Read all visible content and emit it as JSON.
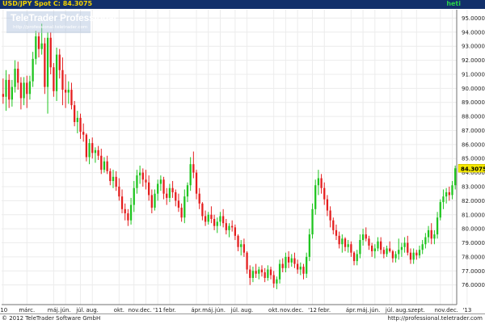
{
  "header": {
    "instrument": "USD/JPY Spot C: 84.3075",
    "interval": "heti",
    "period": "heti"
  },
  "watermark": {
    "brand": "TeleTrader Professional",
    "url": "http://professional.teletrader.com"
  },
  "footer": {
    "copyright": "© 2012 TeleTrader Software GmbH",
    "url": "http://professional.teletrader.com"
  },
  "colors": {
    "up": "#1fc41f",
    "down": "#e41e1e",
    "grid": "#ececec",
    "title_bg": "#12306b",
    "last_price_bg": "#f4e800"
  },
  "chart_data": {
    "type": "candlestick",
    "grid": true,
    "y_axis_side": "right",
    "ylim": [
      74.6,
      95.6
    ],
    "last_price": "84.3075",
    "y_ticks": [
      "76.0000",
      "77.0000",
      "78.0000",
      "79.0000",
      "80.0000",
      "81.0000",
      "82.0000",
      "83.0000",
      "84.0000",
      "85.0000",
      "86.0000",
      "87.0000",
      "88.0000",
      "89.0000",
      "90.0000",
      "91.0000",
      "92.0000",
      "93.0000",
      "94.0000",
      "95.0000"
    ],
    "x_ticks": [
      {
        "i": 0,
        "label": "'10"
      },
      {
        "i": 8,
        "label": "márc."
      },
      {
        "i": 17,
        "label": "máj."
      },
      {
        "i": 21,
        "label": "jún."
      },
      {
        "i": 26,
        "label": "júl."
      },
      {
        "i": 30,
        "label": "aug."
      },
      {
        "i": 39,
        "label": "okt."
      },
      {
        "i": 44,
        "label": "nov."
      },
      {
        "i": 48,
        "label": "dec."
      },
      {
        "i": 52,
        "label": "'11"
      },
      {
        "i": 56,
        "label": "febr."
      },
      {
        "i": 65,
        "label": "ápr."
      },
      {
        "i": 69,
        "label": "máj."
      },
      {
        "i": 73,
        "label": "jún."
      },
      {
        "i": 78,
        "label": "júl."
      },
      {
        "i": 82,
        "label": "aug."
      },
      {
        "i": 91,
        "label": "okt."
      },
      {
        "i": 95,
        "label": "nov."
      },
      {
        "i": 99,
        "label": "dec."
      },
      {
        "i": 104,
        "label": "'12"
      },
      {
        "i": 108,
        "label": "febr."
      },
      {
        "i": 117,
        "label": "ápr."
      },
      {
        "i": 121,
        "label": "máj."
      },
      {
        "i": 125,
        "label": "jún."
      },
      {
        "i": 130,
        "label": "júl."
      },
      {
        "i": 134,
        "label": "aug."
      },
      {
        "i": 139,
        "label": "szept."
      },
      {
        "i": 147,
        "label": "nov."
      },
      {
        "i": 151,
        "label": "dec."
      },
      {
        "i": 156,
        "label": "'13"
      }
    ],
    "candles": [
      [
        89.6,
        90.7,
        88.9,
        89.4
      ],
      [
        89.4,
        91.3,
        88.4,
        90.6
      ],
      [
        90.6,
        91.0,
        88.6,
        89.2
      ],
      [
        89.2,
        90.6,
        88.7,
        90.1
      ],
      [
        90.1,
        92.0,
        89.7,
        91.4
      ],
      [
        91.4,
        91.9,
        89.9,
        90.4
      ],
      [
        90.4,
        90.8,
        88.5,
        89.3
      ],
      [
        89.3,
        90.8,
        88.8,
        90.4
      ],
      [
        90.4,
        90.9,
        88.6,
        89.6
      ],
      [
        89.6,
        90.9,
        89.2,
        90.5
      ],
      [
        90.5,
        92.6,
        90.1,
        92.1
      ],
      [
        92.1,
        94.1,
        91.7,
        93.7
      ],
      [
        93.7,
        94.0,
        92.2,
        92.8
      ],
      [
        92.8,
        94.6,
        92.4,
        93.2
      ],
      [
        93.2,
        93.6,
        89.6,
        90.1
      ],
      [
        90.1,
        94.0,
        88.2,
        93.6
      ],
      [
        93.6,
        94.0,
        91.0,
        91.5
      ],
      [
        91.5,
        91.8,
        89.4,
        89.8
      ],
      [
        89.8,
        92.9,
        89.1,
        92.4
      ],
      [
        92.4,
        92.8,
        90.7,
        91.3
      ],
      [
        91.3,
        92.2,
        88.8,
        89.9
      ],
      [
        89.9,
        91.0,
        88.6,
        89.7
      ],
      [
        89.7,
        90.5,
        88.9,
        89.9
      ],
      [
        89.9,
        90.4,
        88.5,
        88.8
      ],
      [
        88.8,
        89.1,
        87.3,
        87.6
      ],
      [
        87.6,
        88.4,
        86.8,
        87.9
      ],
      [
        87.9,
        88.2,
        86.4,
        86.9
      ],
      [
        86.9,
        87.5,
        86.2,
        86.7
      ],
      [
        86.7,
        86.8,
        84.8,
        85.1
      ],
      [
        85.1,
        86.4,
        84.6,
        86.1
      ],
      [
        86.1,
        86.5,
        85.0,
        85.4
      ],
      [
        85.4,
        85.8,
        84.7,
        85.6
      ],
      [
        85.6,
        85.9,
        84.9,
        85.2
      ],
      [
        85.2,
        85.7,
        83.9,
        84.2
      ],
      [
        84.2,
        85.1,
        84.0,
        84.8
      ],
      [
        84.8,
        85.2,
        83.9,
        84.1
      ],
      [
        84.1,
        84.3,
        83.1,
        83.4
      ],
      [
        83.4,
        84.2,
        82.9,
        83.7
      ],
      [
        83.7,
        84.1,
        82.7,
        83.0
      ],
      [
        83.0,
        83.6,
        82.0,
        82.3
      ],
      [
        82.3,
        82.8,
        81.1,
        81.4
      ],
      [
        81.4,
        81.8,
        80.6,
        81.1
      ],
      [
        81.1,
        81.4,
        80.2,
        80.6
      ],
      [
        80.6,
        82.2,
        80.3,
        81.7
      ],
      [
        81.7,
        83.4,
        81.2,
        82.9
      ],
      [
        82.9,
        84.2,
        82.5,
        83.8
      ],
      [
        83.8,
        84.5,
        83.2,
        84.0
      ],
      [
        84.0,
        84.3,
        83.0,
        83.5
      ],
      [
        83.5,
        84.2,
        82.8,
        83.3
      ],
      [
        83.3,
        83.8,
        82.0,
        82.4
      ],
      [
        82.4,
        82.8,
        81.1,
        81.5
      ],
      [
        81.5,
        82.8,
        81.3,
        82.5
      ],
      [
        82.5,
        83.5,
        82.0,
        83.2
      ],
      [
        83.2,
        83.8,
        82.7,
        83.5
      ],
      [
        83.5,
        83.7,
        82.1,
        82.5
      ],
      [
        82.5,
        82.9,
        81.7,
        82.2
      ],
      [
        82.2,
        83.2,
        81.9,
        82.9
      ],
      [
        82.9,
        83.4,
        82.2,
        82.6
      ],
      [
        82.6,
        82.8,
        81.6,
        82.0
      ],
      [
        82.0,
        82.5,
        81.2,
        81.5
      ],
      [
        81.5,
        81.8,
        80.5,
        80.8
      ],
      [
        80.8,
        82.8,
        80.4,
        82.3
      ],
      [
        82.3,
        83.3,
        81.9,
        83.1
      ],
      [
        83.1,
        85.1,
        82.7,
        84.6
      ],
      [
        84.6,
        85.5,
        83.6,
        84.0
      ],
      [
        84.0,
        84.2,
        82.1,
        82.5
      ],
      [
        82.5,
        82.9,
        81.4,
        81.8
      ],
      [
        81.8,
        81.9,
        80.6,
        80.9
      ],
      [
        80.9,
        81.3,
        80.2,
        80.5
      ],
      [
        80.5,
        81.2,
        80.3,
        81.0
      ],
      [
        81.0,
        81.6,
        80.4,
        80.7
      ],
      [
        80.7,
        81.0,
        79.9,
        80.2
      ],
      [
        80.2,
        80.8,
        79.7,
        80.5
      ],
      [
        80.5,
        81.2,
        80.2,
        80.9
      ],
      [
        80.9,
        81.4,
        80.1,
        80.4
      ],
      [
        80.4,
        80.7,
        79.6,
        79.9
      ],
      [
        79.9,
        80.4,
        79.4,
        80.2
      ],
      [
        80.2,
        80.6,
        79.8,
        80.1
      ],
      [
        80.1,
        80.3,
        79.2,
        79.5
      ],
      [
        79.5,
        79.6,
        78.4,
        78.7
      ],
      [
        78.7,
        79.2,
        78.1,
        78.9
      ],
      [
        78.9,
        79.3,
        78.0,
        78.3
      ],
      [
        78.3,
        78.4,
        76.8,
        77.1
      ],
      [
        77.1,
        77.4,
        76.0,
        76.5
      ],
      [
        76.5,
        77.3,
        76.2,
        77.0
      ],
      [
        77.0,
        77.5,
        76.5,
        76.8
      ],
      [
        76.8,
        77.3,
        76.4,
        77.1
      ],
      [
        77.1,
        77.4,
        76.6,
        76.9
      ],
      [
        76.9,
        77.2,
        76.2,
        76.5
      ],
      [
        76.5,
        77.4,
        76.3,
        77.1
      ],
      [
        77.1,
        77.3,
        76.4,
        76.7
      ],
      [
        76.7,
        77.0,
        75.8,
        76.1
      ],
      [
        76.1,
        76.6,
        75.7,
        76.4
      ],
      [
        76.4,
        77.8,
        76.1,
        77.5
      ],
      [
        77.5,
        77.9,
        76.9,
        77.2
      ],
      [
        77.2,
        78.3,
        76.9,
        78.0
      ],
      [
        78.0,
        78.4,
        77.2,
        77.6
      ],
      [
        77.6,
        78.2,
        77.3,
        77.9
      ],
      [
        77.9,
        78.3,
        77.2,
        77.5
      ],
      [
        77.5,
        77.8,
        76.8,
        77.1
      ],
      [
        77.1,
        77.6,
        76.7,
        77.3
      ],
      [
        77.3,
        77.5,
        76.4,
        76.8
      ],
      [
        76.8,
        78.3,
        76.5,
        78.0
      ],
      [
        78.0,
        80.0,
        77.7,
        79.6
      ],
      [
        79.6,
        81.8,
        79.3,
        81.4
      ],
      [
        81.4,
        83.5,
        81.0,
        83.1
      ],
      [
        83.1,
        84.2,
        82.4,
        83.6
      ],
      [
        83.6,
        83.9,
        82.5,
        82.9
      ],
      [
        82.9,
        83.3,
        81.7,
        82.1
      ],
      [
        82.1,
        82.4,
        80.9,
        81.3
      ],
      [
        81.3,
        81.6,
        80.1,
        80.6
      ],
      [
        80.6,
        80.8,
        79.6,
        79.9
      ],
      [
        79.9,
        80.3,
        79.2,
        79.5
      ],
      [
        79.5,
        79.8,
        78.6,
        78.9
      ],
      [
        78.9,
        79.6,
        78.3,
        79.3
      ],
      [
        79.3,
        79.4,
        78.4,
        78.7
      ],
      [
        78.7,
        79.2,
        78.3,
        78.9
      ],
      [
        78.9,
        79.1,
        78.0,
        78.3
      ],
      [
        78.3,
        78.4,
        77.4,
        77.7
      ],
      [
        77.7,
        78.5,
        77.4,
        78.2
      ],
      [
        78.2,
        79.6,
        77.9,
        79.2
      ],
      [
        79.2,
        80.0,
        78.8,
        79.6
      ],
      [
        79.6,
        80.1,
        79.1,
        79.3
      ],
      [
        79.3,
        79.5,
        78.5,
        78.8
      ],
      [
        78.8,
        79.0,
        78.0,
        78.4
      ],
      [
        78.4,
        78.9,
        77.9,
        78.6
      ],
      [
        78.6,
        79.4,
        78.4,
        79.1
      ],
      [
        79.1,
        79.4,
        78.2,
        78.5
      ],
      [
        78.5,
        78.7,
        77.9,
        78.2
      ],
      [
        78.2,
        78.8,
        78.0,
        78.6
      ],
      [
        78.6,
        79.1,
        78.3,
        78.4
      ],
      [
        78.4,
        78.5,
        77.6,
        77.9
      ],
      [
        77.9,
        78.4,
        77.6,
        78.2
      ],
      [
        78.2,
        79.3,
        77.8,
        78.5
      ],
      [
        78.5,
        79.0,
        78.0,
        78.7
      ],
      [
        78.7,
        79.4,
        78.3,
        79.0
      ],
      [
        79.0,
        79.5,
        78.1,
        78.3
      ],
      [
        78.3,
        78.6,
        77.5,
        77.8
      ],
      [
        77.8,
        78.6,
        77.5,
        78.3
      ],
      [
        78.3,
        78.5,
        77.8,
        78.1
      ],
      [
        78.1,
        78.8,
        77.9,
        78.5
      ],
      [
        78.5,
        79.2,
        78.2,
        78.9
      ],
      [
        78.9,
        79.7,
        78.6,
        79.4
      ],
      [
        79.4,
        80.2,
        79.0,
        79.9
      ],
      [
        79.9,
        80.4,
        78.9,
        79.3
      ],
      [
        79.3,
        79.9,
        78.9,
        79.6
      ],
      [
        79.6,
        81.2,
        79.3,
        80.8
      ],
      [
        80.8,
        82.1,
        80.6,
        81.9
      ],
      [
        81.9,
        82.8,
        81.4,
        82.3
      ],
      [
        82.3,
        82.9,
        81.8,
        82.6
      ],
      [
        82.6,
        83.0,
        82.0,
        82.4
      ],
      [
        82.4,
        83.4,
        82.1,
        83.1
      ],
      [
        83.1,
        84.5,
        82.8,
        84.3075
      ]
    ]
  }
}
